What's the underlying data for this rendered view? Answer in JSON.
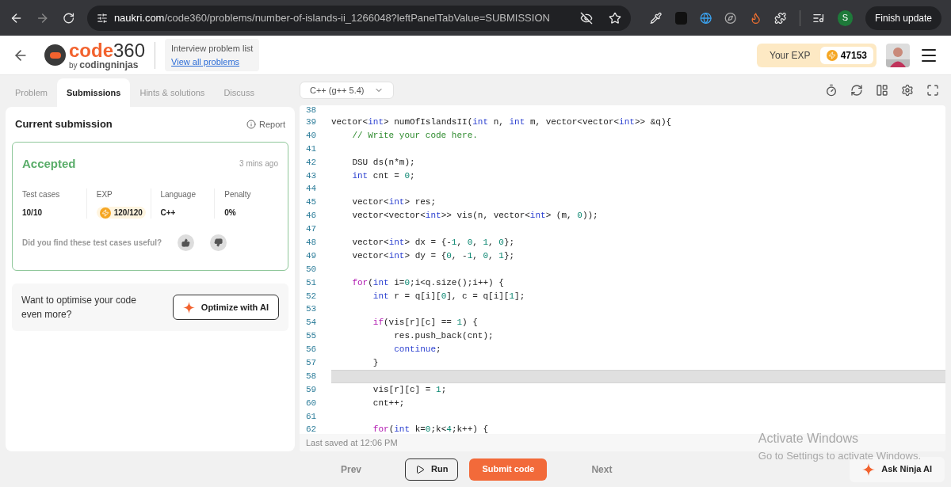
{
  "browser": {
    "url_host": "naukri.com",
    "url_path": "/code360/problems/number-of-islands-ii_1266048?leftPanelTabValue=SUBMISSION",
    "profile_initial": "S",
    "update_button": "Finish update"
  },
  "header": {
    "logo_code": "code",
    "logo_num": "360",
    "logo_by": "by",
    "logo_brand": "codingninjas",
    "problem_list_title": "Interview problem list",
    "problem_list_link": "View all problems",
    "exp_label": "Your EXP",
    "exp_value": "47153"
  },
  "left_tabs": [
    {
      "label": "Problem",
      "selected": false
    },
    {
      "label": "Submissions",
      "selected": true
    },
    {
      "label": "Hints & solutions",
      "selected": false
    },
    {
      "label": "Discuss",
      "selected": false
    }
  ],
  "submission": {
    "title": "Current submission",
    "report": "Report",
    "status": "Accepted",
    "time": "3 mins ago",
    "stats": [
      {
        "label": "Test cases",
        "value": "10/10",
        "kind": "plain"
      },
      {
        "label": "EXP",
        "value": "120/120",
        "kind": "exp"
      },
      {
        "label": "Language",
        "value": "C++",
        "kind": "plain"
      },
      {
        "label": "Penalty",
        "value": "0%",
        "kind": "plain"
      }
    ],
    "feedback_question": "Did you find these test cases useful?"
  },
  "optimise": {
    "text": "Want to optimise your code even more?",
    "button": "Optimize with AI"
  },
  "editor": {
    "language": "C++ (g++ 5.4)",
    "last_saved": "Last saved at 12:06 PM",
    "lines": [
      {
        "n": "38",
        "current": false
      },
      {
        "n": "39",
        "current": false,
        "tokens": [
          {
            "t": "vector<",
            "kind": "plain"
          },
          {
            "t": "int",
            "kind": "type"
          },
          {
            "t": "> numOfIslandsII(",
            "kind": "plain"
          },
          {
            "t": "int",
            "kind": "type"
          },
          {
            "t": " n, ",
            "kind": "plain"
          },
          {
            "t": "int",
            "kind": "type"
          },
          {
            "t": " m, vector<vector<",
            "kind": "plain"
          },
          {
            "t": "int",
            "kind": "type"
          },
          {
            "t": ">> &q){",
            "kind": "plain"
          }
        ]
      },
      {
        "n": "40",
        "current": false,
        "tokens": [
          {
            "t": "    // Write your code here.",
            "kind": "comment"
          }
        ]
      },
      {
        "n": "41",
        "current": false
      },
      {
        "n": "42",
        "current": false,
        "tokens": [
          {
            "t": "    DSU ds(n*m);",
            "kind": "plain"
          }
        ]
      },
      {
        "n": "43",
        "current": false,
        "tokens": [
          {
            "t": "    int",
            "kind": "type"
          },
          {
            "t": " cnt = ",
            "kind": "plain"
          },
          {
            "t": "0",
            "kind": "number"
          },
          {
            "t": ";",
            "kind": "plain"
          }
        ]
      },
      {
        "n": "44",
        "current": false
      },
      {
        "n": "45",
        "current": false,
        "tokens": [
          {
            "t": "    vector<",
            "kind": "plain"
          },
          {
            "t": "int",
            "kind": "type"
          },
          {
            "t": "> res;",
            "kind": "plain"
          }
        ]
      },
      {
        "n": "46",
        "current": false,
        "tokens": [
          {
            "t": "    vector<vector<",
            "kind": "plain"
          },
          {
            "t": "int",
            "kind": "type"
          },
          {
            "t": ">> vis(n, vector<",
            "kind": "plain"
          },
          {
            "t": "int",
            "kind": "type"
          },
          {
            "t": "> (m, ",
            "kind": "plain"
          },
          {
            "t": "0",
            "kind": "number"
          },
          {
            "t": "));",
            "kind": "plain"
          }
        ]
      },
      {
        "n": "47",
        "current": false
      },
      {
        "n": "48",
        "current": false,
        "tokens": [
          {
            "t": "    vector<",
            "kind": "plain"
          },
          {
            "t": "int",
            "kind": "type"
          },
          {
            "t": "> dx = {-",
            "kind": "plain"
          },
          {
            "t": "1",
            "kind": "number"
          },
          {
            "t": ", ",
            "kind": "plain"
          },
          {
            "t": "0",
            "kind": "number"
          },
          {
            "t": ", ",
            "kind": "plain"
          },
          {
            "t": "1",
            "kind": "number"
          },
          {
            "t": ", ",
            "kind": "plain"
          },
          {
            "t": "0",
            "kind": "number"
          },
          {
            "t": "};",
            "kind": "plain"
          }
        ]
      },
      {
        "n": "49",
        "current": false,
        "tokens": [
          {
            "t": "    vector<",
            "kind": "plain"
          },
          {
            "t": "int",
            "kind": "type"
          },
          {
            "t": "> dy = {",
            "kind": "plain"
          },
          {
            "t": "0",
            "kind": "number"
          },
          {
            "t": ", -",
            "kind": "plain"
          },
          {
            "t": "1",
            "kind": "number"
          },
          {
            "t": ", ",
            "kind": "plain"
          },
          {
            "t": "0",
            "kind": "number"
          },
          {
            "t": ", ",
            "kind": "plain"
          },
          {
            "t": "1",
            "kind": "number"
          },
          {
            "t": "};",
            "kind": "plain"
          }
        ]
      },
      {
        "n": "50",
        "current": false
      },
      {
        "n": "51",
        "current": false,
        "tokens": [
          {
            "t": "    for",
            "kind": "keyword"
          },
          {
            "t": "(",
            "kind": "plain"
          },
          {
            "t": "int",
            "kind": "type"
          },
          {
            "t": " i=",
            "kind": "plain"
          },
          {
            "t": "0",
            "kind": "number"
          },
          {
            "t": ";i<q.size();i++) {",
            "kind": "plain"
          }
        ]
      },
      {
        "n": "52",
        "current": false,
        "tokens": [
          {
            "t": "        int",
            "kind": "type"
          },
          {
            "t": " r = q[i][",
            "kind": "plain"
          },
          {
            "t": "0",
            "kind": "number"
          },
          {
            "t": "], c = q[i][",
            "kind": "plain"
          },
          {
            "t": "1",
            "kind": "number"
          },
          {
            "t": "];",
            "kind": "plain"
          }
        ]
      },
      {
        "n": "53",
        "current": false
      },
      {
        "n": "54",
        "current": false,
        "tokens": [
          {
            "t": "        if",
            "kind": "keyword"
          },
          {
            "t": "(vis[r][c] == ",
            "kind": "plain"
          },
          {
            "t": "1",
            "kind": "number"
          },
          {
            "t": ") {",
            "kind": "plain"
          }
        ]
      },
      {
        "n": "55",
        "current": false,
        "tokens": [
          {
            "t": "            res.push_back(cnt);",
            "kind": "plain"
          }
        ]
      },
      {
        "n": "56",
        "current": false,
        "tokens": [
          {
            "t": "            continue",
            "kind": "type"
          },
          {
            "t": ";",
            "kind": "plain"
          }
        ]
      },
      {
        "n": "57",
        "current": false,
        "tokens": [
          {
            "t": "        }",
            "kind": "plain"
          }
        ]
      },
      {
        "n": "58",
        "current": true
      },
      {
        "n": "59",
        "current": false,
        "tokens": [
          {
            "t": "        vis[r][c] = ",
            "kind": "plain"
          },
          {
            "t": "1",
            "kind": "number"
          },
          {
            "t": ";",
            "kind": "plain"
          }
        ]
      },
      {
        "n": "60",
        "current": false,
        "tokens": [
          {
            "t": "        cnt++;",
            "kind": "plain"
          }
        ]
      },
      {
        "n": "61",
        "current": false
      },
      {
        "n": "62",
        "current": false,
        "tokens": [
          {
            "t": "        for",
            "kind": "keyword"
          },
          {
            "t": "(",
            "kind": "plain"
          },
          {
            "t": "int",
            "kind": "type"
          },
          {
            "t": " k=",
            "kind": "plain"
          },
          {
            "t": "0",
            "kind": "number"
          },
          {
            "t": ";k<",
            "kind": "plain"
          },
          {
            "t": "4",
            "kind": "number"
          },
          {
            "t": ";k++) {",
            "kind": "plain"
          }
        ]
      }
    ]
  },
  "footer": {
    "prev": "Prev",
    "run": "Run",
    "submit": "Submit code",
    "next": "Next",
    "ask_ai": "Ask Ninja AI"
  },
  "os_notice": {
    "title": "Activate Windows",
    "text": "Go to Settings to activate Windows."
  }
}
